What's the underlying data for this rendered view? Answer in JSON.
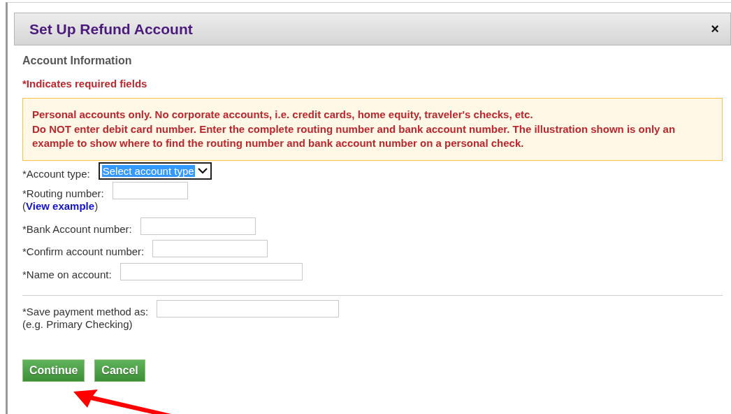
{
  "dialog": {
    "title": "Set Up Refund Account",
    "close": "×"
  },
  "section_title": "Account Information",
  "required_note": "*Indicates required fields",
  "notice": [
    "Personal accounts only. No corporate accounts, i.e. credit cards, home equity, traveler's checks, etc.",
    "Do NOT enter debit card number. Enter the complete routing number and bank account number. The illustration shown is only an example to show where to find the routing number and bank account number on a personal check."
  ],
  "fields": [
    {
      "kind": "select",
      "label": "*Account type:",
      "value": "Select account type",
      "focused": true
    },
    {
      "kind": "text",
      "label": "*Routing number:",
      "link": {
        "before": "(",
        "text": "View example",
        "after": ")"
      }
    },
    {
      "kind": "text",
      "label": "*Bank Account number:"
    },
    {
      "kind": "text",
      "label": "*Confirm account number:"
    },
    {
      "kind": "text",
      "label": "*Name on account:"
    }
  ],
  "save_field": {
    "label": "*Save payment method as:",
    "hint": "(e.g. Primary Checking)"
  },
  "buttons": [
    "Continue",
    "Cancel"
  ]
}
